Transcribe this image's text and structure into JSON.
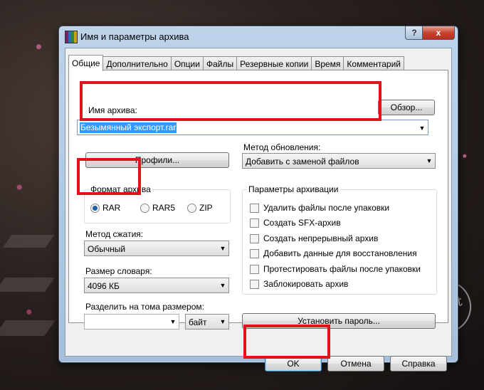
{
  "window": {
    "title": "Имя и параметры архива",
    "help_label": "?",
    "close_label": "x"
  },
  "tabs": [
    {
      "label": "Общие",
      "active": true
    },
    {
      "label": "Дополнительно"
    },
    {
      "label": "Опции"
    },
    {
      "label": "Файлы"
    },
    {
      "label": "Резервные копии"
    },
    {
      "label": "Время"
    },
    {
      "label": "Комментарий"
    }
  ],
  "general": {
    "archive_name_label": "Имя архива:",
    "browse_label": "Обзор...",
    "archive_name_value": "Безымянный экспорт.rar",
    "profiles_label": "Профили...",
    "update_method_label": "Метод обновления:",
    "update_method_value": "Добавить с заменой файлов",
    "format_group_label": "Формат архива",
    "format_rar": "RAR",
    "format_rar5": "RAR5",
    "format_zip": "ZIP",
    "selected_format": "RAR",
    "compression_label": "Метод сжатия:",
    "compression_value": "Обычный",
    "dict_label": "Размер словаря:",
    "dict_value": "4096 КБ",
    "split_label": "Разделить на тома размером:",
    "split_value": "",
    "split_unit": "байт",
    "params_group_label": "Параметры архивации",
    "options": [
      "Удалить файлы после упаковки",
      "Создать SFX-архив",
      "Создать непрерывный архив",
      "Добавить данные для восстановления",
      "Протестировать файлы после упаковки",
      "Заблокировать архив"
    ],
    "password_label": "Установить пароль..."
  },
  "footer": {
    "ok_label": "OK",
    "cancel_label": "Отмена",
    "help_label": "Справка"
  },
  "watermark": "Sovet",
  "colors": {
    "highlight": "#e0121a",
    "selection": "#3399ff"
  }
}
